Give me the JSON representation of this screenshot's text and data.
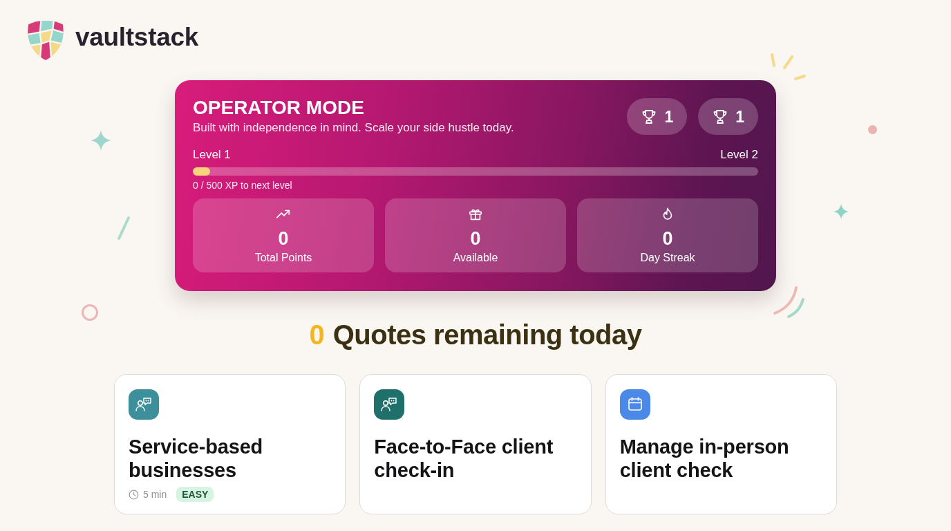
{
  "brand": {
    "name": "vaultstack"
  },
  "hero": {
    "title": "OPERATOR MODE",
    "subtitle": "Built with independence in mind. Scale your side hustle today.",
    "badges": [
      {
        "count": "1"
      },
      {
        "count": "1"
      }
    ],
    "progress": {
      "start_label": "Level 1",
      "end_label": "Level 2",
      "level": 0.03,
      "caption": "0 / 500 XP to next level"
    },
    "stats": [
      {
        "kind": "trend",
        "value": "0",
        "label": "Total Points"
      },
      {
        "kind": "gift",
        "value": "0",
        "label": "Available"
      },
      {
        "kind": "flame",
        "value": "0",
        "label": "Day Streak"
      }
    ]
  },
  "quota": {
    "count": "0",
    "text": "Quotes remaining today"
  },
  "cards": [
    {
      "kind": "chat",
      "color": "#3d8f9c",
      "title": "Service-based businesses",
      "duration": "5 min",
      "difficulty": "EASY"
    },
    {
      "kind": "chat",
      "color": "#1f6f6b",
      "title": "Face-to-Face client check-in"
    },
    {
      "kind": "calendar",
      "color": "#4a89e8",
      "title": "Manage in-person client check"
    }
  ]
}
